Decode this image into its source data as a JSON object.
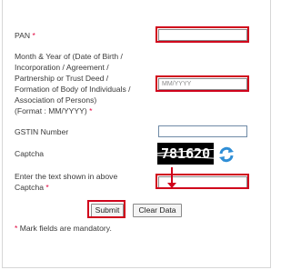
{
  "form": {
    "pan": {
      "label": "PAN",
      "required": "*"
    },
    "date": {
      "label_lines": [
        "Month & Year of (Date of Birth /",
        "Incorporation / Agreement /",
        "Partnership or Trust Deed /",
        "Formation of Body of Individuals /",
        "Association of Persons)",
        "(Format : MM/YYYY)"
      ],
      "required": "*",
      "placeholder": "MM/YYYY"
    },
    "gstin": {
      "label": "GSTIN Number"
    },
    "captcha": {
      "label": "Captcha",
      "image_text": "781620",
      "refresh_icon": "refresh-icon"
    },
    "captcha_input": {
      "label_lines": [
        "Enter the text shown in above",
        "Captcha"
      ],
      "required": "*"
    }
  },
  "buttons": {
    "submit": "Submit",
    "clear": "Clear Data"
  },
  "note": {
    "asterisk": "*",
    "text": " Mark fields are mandatory."
  },
  "colors": {
    "highlight": "#d0021b",
    "required": "#e0003c",
    "refresh_icon": "#2f8ed6"
  }
}
